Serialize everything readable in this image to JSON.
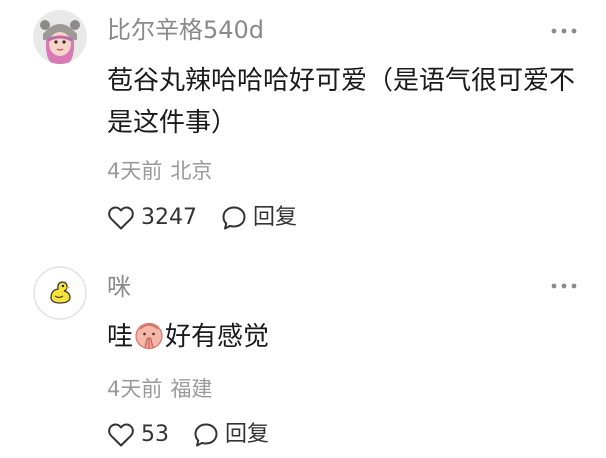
{
  "comments": [
    {
      "username": "比尔辛格540d",
      "avatar_icon": "girl-with-bear-hat-avatar-icon",
      "text": "苞谷丸辣哈哈哈好可爱（是语气很可爱不是这件事）",
      "time": "4天前",
      "location": "北京",
      "like_count": "3247",
      "reply_label": "回复"
    },
    {
      "username": "咪",
      "avatar_icon": "yellow-duck-avatar-icon",
      "text_before_emoji": "哇",
      "emoji_icon": "praying-face-emoji-icon",
      "text_after_emoji": "好有感觉",
      "time": "4天前",
      "location": "福建",
      "like_count": "53",
      "reply_label": "回复"
    }
  ],
  "colors": {
    "username": "#8a8a8a",
    "meta": "#9a9a9a",
    "text": "#1a1a1a",
    "icon": "#333333"
  }
}
